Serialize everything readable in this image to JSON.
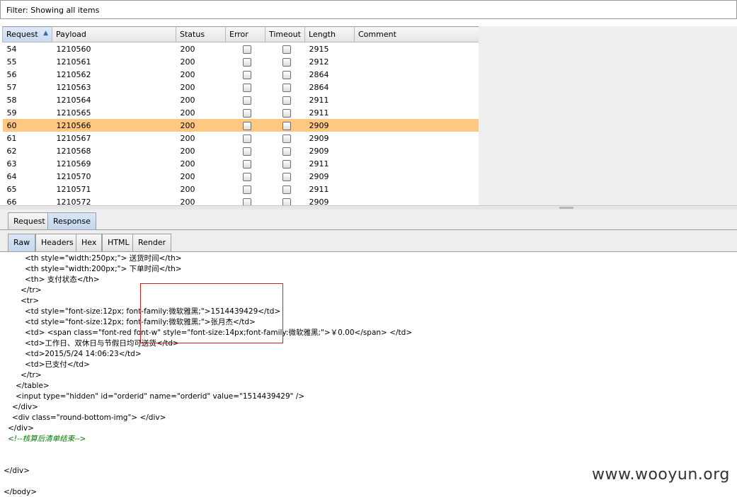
{
  "filter": {
    "label": "Filter: Showing all items"
  },
  "results_table": {
    "columns": [
      "Request",
      "Payload",
      "Status",
      "Error",
      "Timeout",
      "Length",
      "Comment"
    ],
    "sort_indicator": "▲",
    "rows": [
      {
        "request": "54",
        "payload": "1210560",
        "status": "200",
        "length": "2915",
        "selected": false
      },
      {
        "request": "55",
        "payload": "1210561",
        "status": "200",
        "length": "2912",
        "selected": false
      },
      {
        "request": "56",
        "payload": "1210562",
        "status": "200",
        "length": "2864",
        "selected": false
      },
      {
        "request": "57",
        "payload": "1210563",
        "status": "200",
        "length": "2864",
        "selected": false
      },
      {
        "request": "58",
        "payload": "1210564",
        "status": "200",
        "length": "2911",
        "selected": false
      },
      {
        "request": "59",
        "payload": "1210565",
        "status": "200",
        "length": "2911",
        "selected": false
      },
      {
        "request": "60",
        "payload": "1210566",
        "status": "200",
        "length": "2909",
        "selected": true
      },
      {
        "request": "61",
        "payload": "1210567",
        "status": "200",
        "length": "2909",
        "selected": false
      },
      {
        "request": "62",
        "payload": "1210568",
        "status": "200",
        "length": "2909",
        "selected": false
      },
      {
        "request": "63",
        "payload": "1210569",
        "status": "200",
        "length": "2911",
        "selected": false
      },
      {
        "request": "64",
        "payload": "1210570",
        "status": "200",
        "length": "2909",
        "selected": false
      },
      {
        "request": "65",
        "payload": "1210571",
        "status": "200",
        "length": "2911",
        "selected": false
      },
      {
        "request": "66",
        "payload": "1210572",
        "status": "200",
        "length": "2909",
        "selected": false
      }
    ]
  },
  "tabs_outer": [
    "Request",
    "Response"
  ],
  "tabs_inner": [
    "Raw",
    "Headers",
    "Hex",
    "HTML",
    "Render"
  ],
  "response_lines": [
    "<th style=\"width:250px;\"> 送货时间</th>",
    "<th style=\"width:200px;\"> 下单时间</th>",
    "<th> 支付状态</th>",
    "</tr>",
    "<tr>",
    "<td style=\"font-size:12px; font-family:微软雅黑;\">1514439429</td>",
    "<td style=\"font-size:12px; font-family:微软雅黑;\">张月杰</td>",
    "<td> <span class=\"font-red font-w\" style=\"font-size:14px;font-family:微软雅黑;\">￥0.00</span> </td>",
    "<td>工作日、双休日与节假日均可送货</td>",
    "<td>2015/5/24 14:06:23</td>",
    "<td>已支付</td>",
    "</tr>",
    "</table>",
    "<input type=\"hidden\" id=\"orderid\" name=\"orderid\" value=\"1514439429\" />",
    "</div>",
    "<div class=\"round-bottom-img\"> </div>",
    "</div>",
    "<!--核算后清单结束-->",
    "</div>",
    "</body>"
  ],
  "watermark": "www.wooyun.org"
}
